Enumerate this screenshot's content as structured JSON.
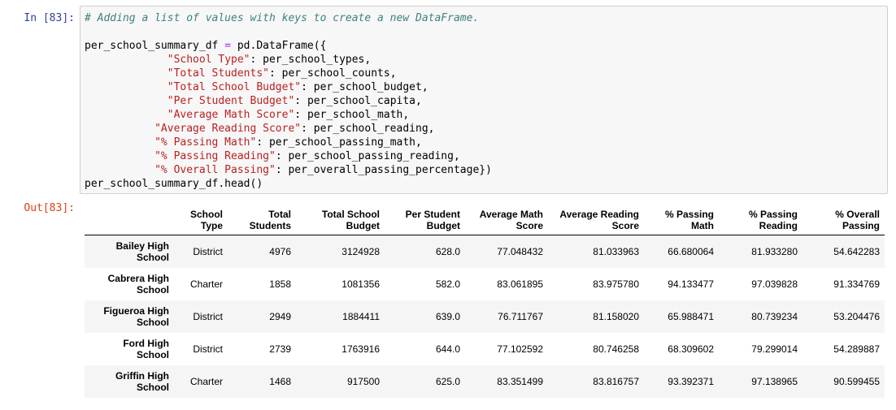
{
  "cell": {
    "in_prompt": "In [83]:",
    "out_prompt": "Out[83]:",
    "code_lines": [
      [
        {
          "t": "# Adding a list of values with keys to create a new DataFrame.",
          "c": "cm"
        }
      ],
      [],
      [
        {
          "t": "per_school_summary_df "
        },
        {
          "t": "=",
          "c": "op"
        },
        {
          "t": " pd.DataFrame({"
        }
      ],
      [
        {
          "t": "             "
        },
        {
          "t": "\"School Type\"",
          "c": "s"
        },
        {
          "t": ": per_school_types,"
        }
      ],
      [
        {
          "t": "             "
        },
        {
          "t": "\"Total Students\"",
          "c": "s"
        },
        {
          "t": ": per_school_counts,"
        }
      ],
      [
        {
          "t": "             "
        },
        {
          "t": "\"Total School Budget\"",
          "c": "s"
        },
        {
          "t": ": per_school_budget,"
        }
      ],
      [
        {
          "t": "             "
        },
        {
          "t": "\"Per Student Budget\"",
          "c": "s"
        },
        {
          "t": ": per_school_capita,"
        }
      ],
      [
        {
          "t": "             "
        },
        {
          "t": "\"Average Math Score\"",
          "c": "s"
        },
        {
          "t": ": per_school_math,"
        }
      ],
      [
        {
          "t": "           "
        },
        {
          "t": "\"Average Reading Score\"",
          "c": "s"
        },
        {
          "t": ": per_school_reading,"
        }
      ],
      [
        {
          "t": "           "
        },
        {
          "t": "\"% Passing Math\"",
          "c": "s"
        },
        {
          "t": ": per_school_passing_math,"
        }
      ],
      [
        {
          "t": "           "
        },
        {
          "t": "\"% Passing Reading\"",
          "c": "s"
        },
        {
          "t": ": per_school_passing_reading,"
        }
      ],
      [
        {
          "t": "           "
        },
        {
          "t": "\"% Overall Passing\"",
          "c": "s"
        },
        {
          "t": ": per_overall_passing_percentage})"
        }
      ],
      [
        {
          "t": "per_school_summary_df.head()"
        }
      ]
    ]
  },
  "dataframe": {
    "columns": [
      {
        "line1": "School",
        "line2": "Type"
      },
      {
        "line1": "Total",
        "line2": "Students"
      },
      {
        "line1": "Total School",
        "line2": "Budget"
      },
      {
        "line1": "Per Student",
        "line2": "Budget"
      },
      {
        "line1": "Average Math",
        "line2": "Score"
      },
      {
        "line1": "Average Reading",
        "line2": "Score"
      },
      {
        "line1": "% Passing",
        "line2": "Math"
      },
      {
        "line1": "% Passing",
        "line2": "Reading"
      },
      {
        "line1": "% Overall",
        "line2": "Passing"
      }
    ],
    "rows": [
      {
        "index1": "Bailey High",
        "index2": "School",
        "values": [
          "District",
          "4976",
          "3124928",
          "628.0",
          "77.048432",
          "81.033963",
          "66.680064",
          "81.933280",
          "54.642283"
        ]
      },
      {
        "index1": "Cabrera High",
        "index2": "School",
        "values": [
          "Charter",
          "1858",
          "1081356",
          "582.0",
          "83.061895",
          "83.975780",
          "94.133477",
          "97.039828",
          "91.334769"
        ]
      },
      {
        "index1": "Figueroa High",
        "index2": "School",
        "values": [
          "District",
          "2949",
          "1884411",
          "639.0",
          "76.711767",
          "81.158020",
          "65.988471",
          "80.739234",
          "53.204476"
        ]
      },
      {
        "index1": "Ford High",
        "index2": "School",
        "values": [
          "District",
          "2739",
          "1763916",
          "644.0",
          "77.102592",
          "80.746258",
          "68.309602",
          "79.299014",
          "54.289887"
        ]
      },
      {
        "index1": "Griffin High",
        "index2": "School",
        "values": [
          "Charter",
          "1468",
          "917500",
          "625.0",
          "83.351499",
          "83.816757",
          "93.392371",
          "97.138965",
          "90.599455"
        ]
      }
    ]
  }
}
